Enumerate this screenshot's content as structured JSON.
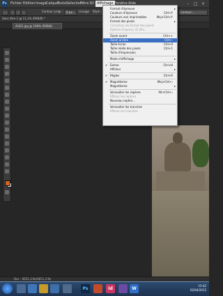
{
  "menubar": {
    "logo": "Ps",
    "items": [
      "Fichier",
      "Edition",
      "Image",
      "Calque",
      "Texte",
      "Sélection",
      "Filtre",
      "3D",
      "Affichage",
      "Fenêtre",
      "Aide"
    ],
    "active": "Affichage"
  },
  "options": {
    "contour_label": "Contour progr. :",
    "contour_value": "0 px",
    "lissage": "Lissage",
    "style_label": "Style :",
    "right": "Contour..."
  },
  "info": {
    "text": "Sans titre-1 @ 11,1% (RVB/8) *"
  },
  "tab": {
    "label": "AGD1.jpg @ 100% (RVB/8)"
  },
  "dropdown": [
    {
      "label": "Format d'épreuve",
      "shortcut": "",
      "arrow": true
    },
    {
      "label": "Couleurs d'épreuve",
      "shortcut": "Ctrl+Y"
    },
    {
      "label": "Couleurs non imprimables",
      "shortcut": "Maj+Ctrl+Y"
    },
    {
      "label": "Format des pixels",
      "shortcut": "",
      "arrow": true
    },
    {
      "label": "Correction du format des pixels",
      "disabled": true
    },
    {
      "label": "Options d'aperçu 32 bits...",
      "disabled": true
    },
    {
      "sep": true
    },
    {
      "label": "Zoom avant",
      "shortcut": "Ctrl++"
    },
    {
      "label": "Zoom arrière",
      "shortcut": "Ctrl+-",
      "highlight": true
    },
    {
      "label": "Taille écran",
      "shortcut": "Ctrl+0"
    },
    {
      "label": "Taille réelle des pixels",
      "shortcut": "Ctrl+1"
    },
    {
      "label": "Taille d'impression"
    },
    {
      "sep": true
    },
    {
      "label": "Mode d'affichage",
      "arrow": true
    },
    {
      "sep": true
    },
    {
      "label": "Extras",
      "shortcut": "Ctrl+H",
      "check": true
    },
    {
      "label": "Afficher",
      "arrow": true
    },
    {
      "sep": true
    },
    {
      "label": "Règles",
      "shortcut": "Ctrl+R",
      "check": true
    },
    {
      "sep": true
    },
    {
      "label": "Magnétisme",
      "shortcut": "Maj+Ctrl+;",
      "check": true
    },
    {
      "label": "Magnétisme",
      "arrow": true
    },
    {
      "sep": true
    },
    {
      "label": "Verrouiller les repères",
      "shortcut": "Alt+Ctrl+;"
    },
    {
      "label": "Effacer les repères",
      "disabled": true
    },
    {
      "label": "Nouveau repère..."
    },
    {
      "sep": true
    },
    {
      "label": "Verrouiller les tranches"
    },
    {
      "label": "Effacer les tranches",
      "disabled": true
    }
  ],
  "status": {
    "text": "Doc : 6651,3 Ko/6651,3 Ko"
  },
  "taskbar": {
    "apps": [
      "Ps",
      "Id",
      "W"
    ],
    "time": "15:42",
    "date": "02/04/2015"
  },
  "colors": {
    "foreground": "#d4631f",
    "background": "#ffffff",
    "highlight": "#3a6fc4"
  }
}
